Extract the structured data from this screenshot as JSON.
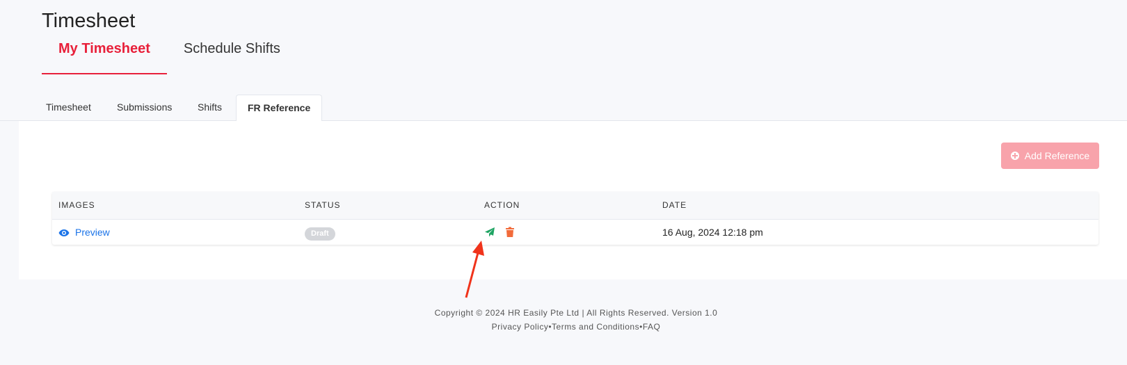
{
  "page": {
    "title": "Timesheet"
  },
  "main_tabs": [
    {
      "label": "My Timesheet",
      "active": true
    },
    {
      "label": "Schedule Shifts",
      "active": false
    }
  ],
  "sub_tabs": [
    {
      "label": "Timesheet",
      "active": false
    },
    {
      "label": "Submissions",
      "active": false
    },
    {
      "label": "Shifts",
      "active": false
    },
    {
      "label": "FR Reference",
      "active": true
    }
  ],
  "toolbar": {
    "add_label": "Add Reference",
    "add_icon": "plus-circle-icon"
  },
  "table": {
    "columns": [
      "IMAGES",
      "STATUS",
      "ACTION",
      "DATE"
    ],
    "rows": [
      {
        "image_label": "Preview",
        "image_icon": "eye-icon",
        "status": "Draft",
        "actions": [
          "send-icon",
          "trash-icon"
        ],
        "date": "16 Aug, 2024 12:18 pm"
      }
    ]
  },
  "footer": {
    "copyright": "Copyright © 2024 HR Easily Pte Ltd | All Rights Reserved. Version 1.0",
    "links": [
      "Privacy Policy",
      "Terms and Conditions",
      "FAQ"
    ],
    "separator": "•"
  },
  "colors": {
    "accent": "#e8203a",
    "add_button": "#f8a3ab",
    "link": "#1a73e8",
    "send": "#1fa463",
    "delete": "#f26b3a",
    "annotation_arrow": "#f0331b"
  }
}
